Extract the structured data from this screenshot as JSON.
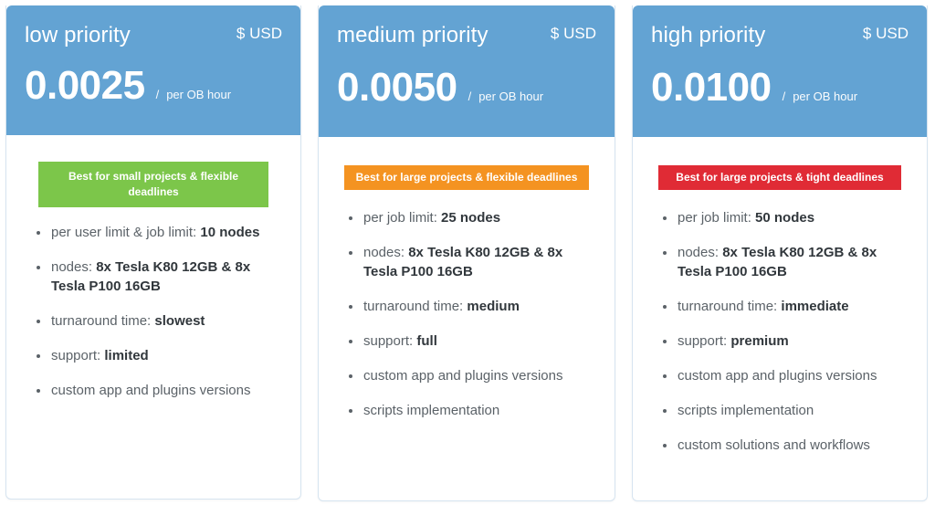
{
  "cards": [
    {
      "id": "low-priority",
      "plan_name": "low priority",
      "currency": "$ USD",
      "price": "0.0025",
      "slash": "/",
      "unit": "per OB hour",
      "badge": {
        "text": "Best for small projects & flexible deadlines",
        "color": "#7cc64a",
        "style": "green"
      },
      "features": [
        {
          "label": "per user limit & job limit:",
          "value": "10 nodes"
        },
        {
          "label": "nodes:",
          "value": "8x Tesla K80 12GB & 8x Tesla P100 16GB"
        },
        {
          "label": "turnaround time:",
          "value": "slowest"
        },
        {
          "label": "support:",
          "value": "limited"
        },
        {
          "label": "custom app and plugins versions",
          "value": ""
        }
      ]
    },
    {
      "id": "medium-priority",
      "plan_name": "medium priority",
      "currency": "$ USD",
      "price": "0.0050",
      "slash": "/",
      "unit": "per OB hour",
      "badge": {
        "text": "Best for large projects & flexible deadlines",
        "color": "#f49321",
        "style": "orange"
      },
      "features": [
        {
          "label": "per job limit:",
          "value": "25 nodes"
        },
        {
          "label": "nodes:",
          "value": "8x Tesla K80 12GB & 8x Tesla P100 16GB"
        },
        {
          "label": "turnaround time:",
          "value": "medium"
        },
        {
          "label": "support:",
          "value": "full"
        },
        {
          "label": "custom app and plugins versions",
          "value": ""
        },
        {
          "label": "scripts implementation",
          "value": ""
        }
      ]
    },
    {
      "id": "high-priority",
      "plan_name": "high priority",
      "currency": "$ USD",
      "price": "0.0100",
      "slash": "/",
      "unit": "per OB hour",
      "badge": {
        "text": "Best for large projects & tight deadlines",
        "color": "#e02b35",
        "style": "red"
      },
      "features": [
        {
          "label": "per job limit:",
          "value": "50 nodes"
        },
        {
          "label": "nodes:",
          "value": "8x Tesla K80 12GB & 8x Tesla P100 16GB"
        },
        {
          "label": "turnaround time:",
          "value": "immediate"
        },
        {
          "label": "support:",
          "value": "premium"
        },
        {
          "label": "custom app and plugins versions",
          "value": ""
        },
        {
          "label": "scripts implementation",
          "value": ""
        },
        {
          "label": "custom solutions and workflows",
          "value": ""
        }
      ]
    }
  ],
  "theme": {
    "header_blue": "#63a3d3",
    "card_border": "#d6e4f0",
    "text_muted": "#5b6268",
    "text_strong": "#31373c"
  }
}
